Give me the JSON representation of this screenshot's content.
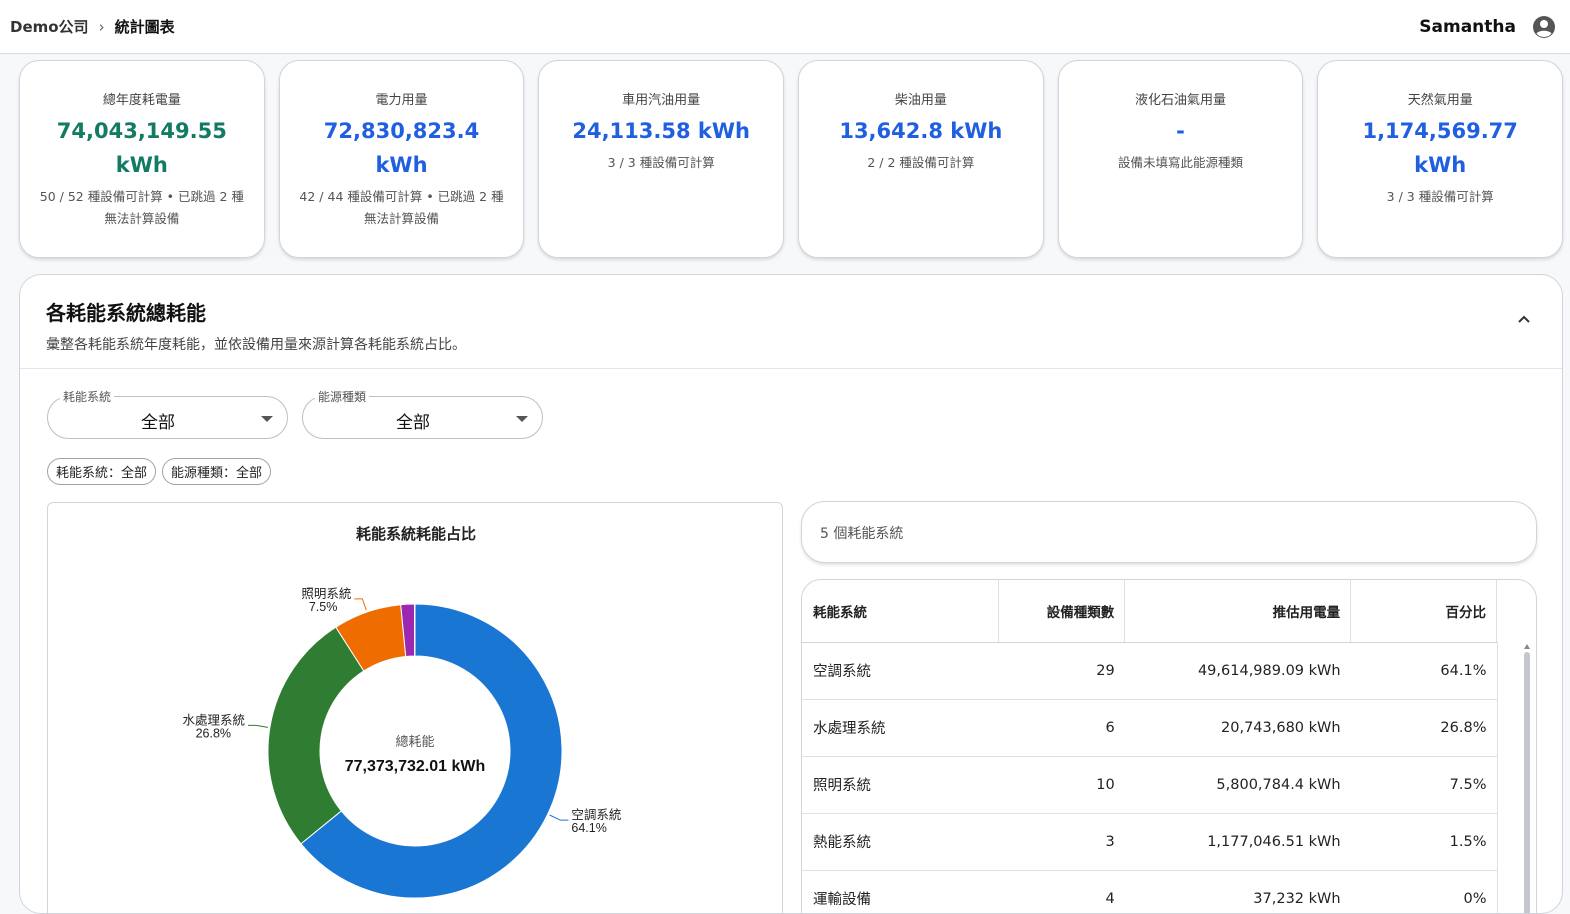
{
  "breadcrumb": {
    "company": "Demo公司",
    "separator": "›",
    "current": "統計圖表"
  },
  "user": {
    "name": "Samantha"
  },
  "cards": [
    {
      "title": "總年度耗電量",
      "value": "74,043,149.55 kWh",
      "note": "50 / 52 種設備可計算 • 已跳過 2 種無法計算設備"
    },
    {
      "title": "電力用量",
      "value": "72,830,823.4 kWh",
      "note": "42 / 44 種設備可計算 • 已跳過 2 種無法計算設備"
    },
    {
      "title": "車用汽油用量",
      "value": "24,113.58 kWh",
      "note": "3 / 3 種設備可計算"
    },
    {
      "title": "柴油用量",
      "value": "13,642.8 kWh",
      "note": "2 / 2 種設備可計算"
    },
    {
      "title": "液化石油氣用量",
      "value": "-",
      "note": "設備未填寫此能源種類"
    },
    {
      "title": "天然氣用量",
      "value": "1,174,569.77 kWh",
      "note": "3 / 3 種設備可計算"
    }
  ],
  "section": {
    "title": "各耗能系統總耗能",
    "description": "彙整各耗能系統年度耗能，並依設備用量來源計算各耗能系統占比。"
  },
  "filters": {
    "system": {
      "label": "耗能系統",
      "value": "全部"
    },
    "energy": {
      "label": "能源種類",
      "value": "全部"
    }
  },
  "chips": [
    "耗能系統：全部",
    "能源種類：全部"
  ],
  "search": {
    "text": "5 個耗能系統"
  },
  "table": {
    "headers": [
      "耗能系統",
      "設備種類數",
      "推估用電量",
      "百分比"
    ],
    "rows": [
      [
        "空調系統",
        "29",
        "49,614,989.09 kWh",
        "64.1%"
      ],
      [
        "水處理系統",
        "6",
        "20,743,680 kWh",
        "26.8%"
      ],
      [
        "照明系統",
        "10",
        "5,800,784.4 kWh",
        "7.5%"
      ],
      [
        "熱能系統",
        "3",
        "1,177,046.51 kWh",
        "1.5%"
      ],
      [
        "運輸設備",
        "4",
        "37,232 kWh",
        "0%"
      ]
    ]
  },
  "colors": {
    "accent_blue": "#1f5fe0",
    "accent_green": "#137a63"
  },
  "chart_data": {
    "type": "pie",
    "title": "耗能系統耗能占比",
    "center_label": "總耗能",
    "center_value": "77,373,732.01 kWh",
    "slices": [
      {
        "name": "空調系統",
        "value": 64.1,
        "label": "64.1%",
        "color": "#1976d2"
      },
      {
        "name": "水處理系統",
        "value": 26.8,
        "label": "26.8%",
        "color": "#2e7d32"
      },
      {
        "name": "照明系統",
        "value": 7.5,
        "label": "7.5%",
        "color": "#ef6c00"
      },
      {
        "name": "熱能系統",
        "value": 1.5,
        "label": "",
        "color": "#9c27b0"
      },
      {
        "name": "運輸設備",
        "value": 0.05,
        "label": "",
        "color": "#9c27b0"
      }
    ]
  }
}
